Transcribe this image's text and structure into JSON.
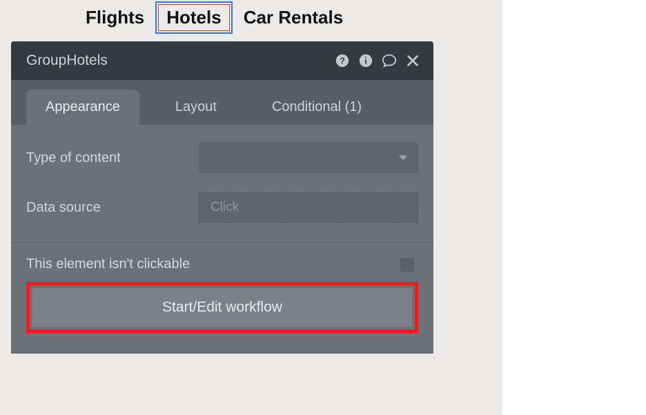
{
  "canvas": {
    "tabs": [
      {
        "label": "Flights",
        "selected": false
      },
      {
        "label": "Hotels",
        "selected": true
      },
      {
        "label": "Car Rentals",
        "selected": false
      }
    ]
  },
  "inspector": {
    "title": "GroupHotels",
    "header_icons": [
      "help-icon",
      "info-icon",
      "comment-icon",
      "close-icon"
    ],
    "tabs": {
      "appearance": "Appearance",
      "layout": "Layout",
      "conditional": "Conditional (1)",
      "active": "appearance"
    },
    "fields": {
      "type_of_content_label": "Type of content",
      "data_source_label": "Data source",
      "data_source_placeholder": "Click"
    },
    "checkbox_label": "This element isn't clickable",
    "workflow_button": "Start/Edit workflow",
    "highlight_color": "#ff1616"
  }
}
